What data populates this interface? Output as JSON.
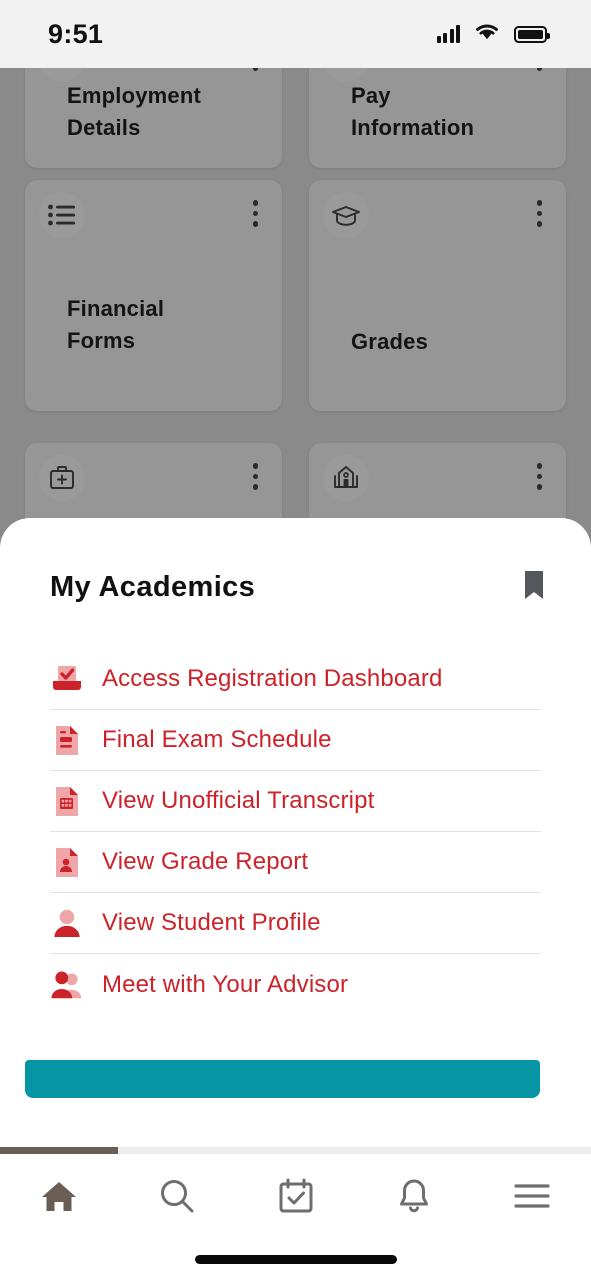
{
  "status_bar": {
    "time": "9:51",
    "icons": [
      "cellular-signal-icon",
      "wifi-icon",
      "battery-icon"
    ]
  },
  "backdrop": {
    "tiles": [
      {
        "label": "Employment\nDetails",
        "icon": "",
        "menu": "kebab-menu-icon"
      },
      {
        "label": "Pay\nInformation",
        "icon": "",
        "menu": "kebab-menu-icon"
      },
      {
        "label": "Financial\nForms",
        "icon": "list-icon",
        "menu": "kebab-menu-icon"
      },
      {
        "label": "Grades",
        "icon": "graduation-cap-icon",
        "menu": "kebab-menu-icon"
      },
      {
        "label": "",
        "icon": "medical-kit-icon",
        "menu": "kebab-menu-icon"
      },
      {
        "label": "",
        "icon": "campus-building-icon",
        "menu": "kebab-menu-icon"
      }
    ]
  },
  "sheet": {
    "title": "My Academics",
    "bookmark_icon": "bookmark-icon",
    "links": [
      {
        "label": "Access Registration Dashboard",
        "icon": "registration-tray-check-icon"
      },
      {
        "label": "Final Exam Schedule",
        "icon": "exam-document-icon"
      },
      {
        "label": "View Unofficial Transcript",
        "icon": "transcript-grid-document-icon"
      },
      {
        "label": "View Grade Report",
        "icon": "grade-report-person-document-icon"
      },
      {
        "label": "View Student Profile",
        "icon": "person-icon"
      },
      {
        "label": "Meet with Your Advisor",
        "icon": "two-people-icon"
      }
    ],
    "cta_label": ""
  },
  "tabbar": {
    "items": [
      {
        "name": "home",
        "icon": "home-icon",
        "active": true
      },
      {
        "name": "search",
        "icon": "search-icon",
        "active": false
      },
      {
        "name": "calendar",
        "icon": "calendar-check-icon",
        "active": false
      },
      {
        "name": "notifications",
        "icon": "bell-icon",
        "active": false
      },
      {
        "name": "menu",
        "icon": "hamburger-menu-icon",
        "active": false
      }
    ]
  },
  "colors": {
    "accent_red": "#cc2229",
    "accent_teal": "#0595a5",
    "scroll_thumb": "#6a5d54",
    "backdrop_dim": "#8a8a8a",
    "tile": "#969696"
  }
}
